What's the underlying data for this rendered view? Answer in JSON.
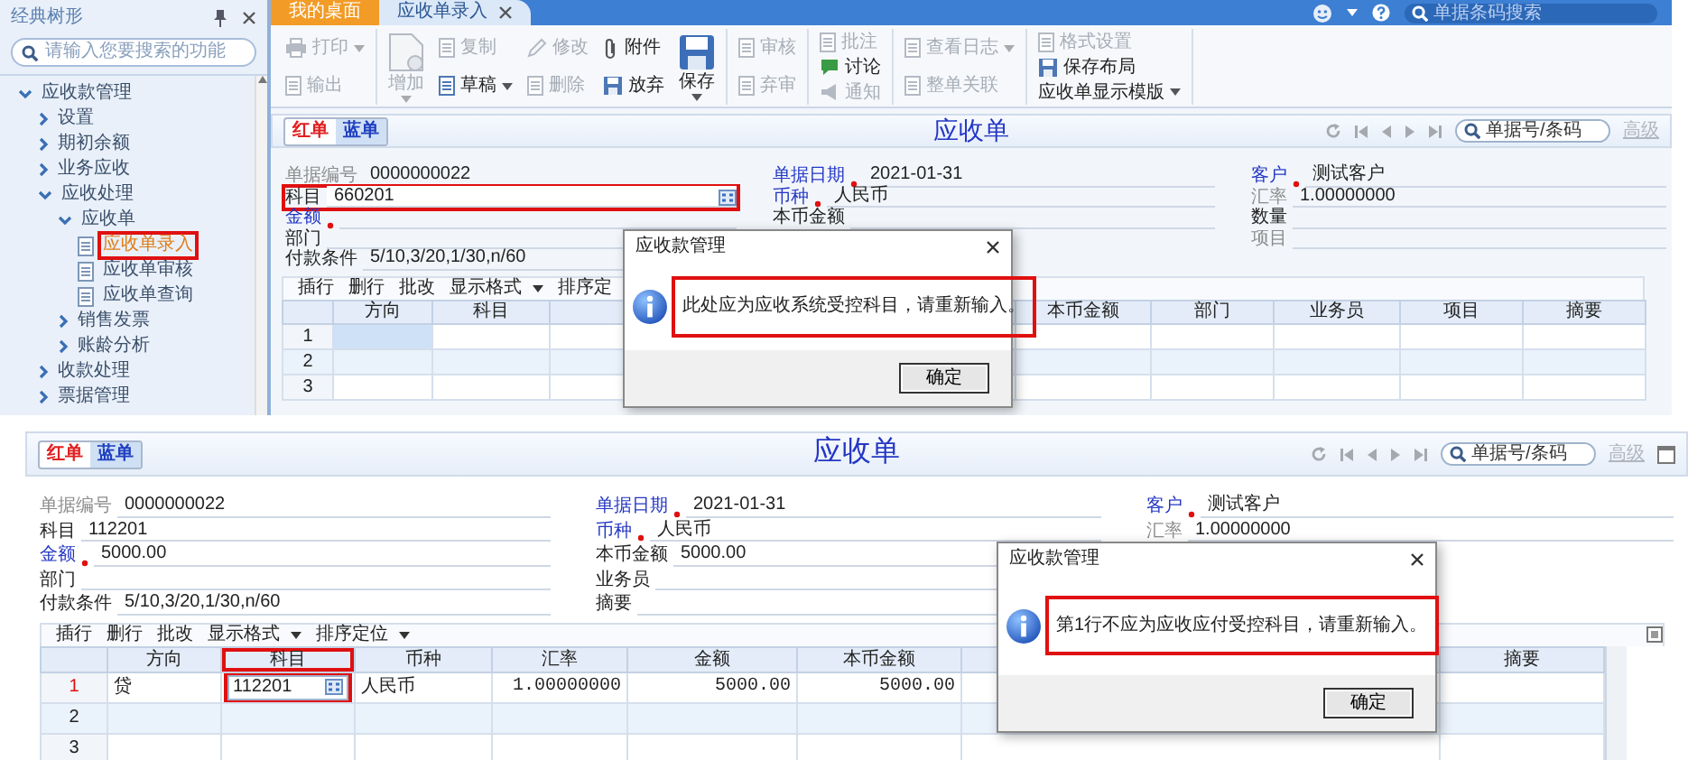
{
  "top_screen": {
    "sidebar": {
      "title": "经典树形",
      "search": {
        "placeholder": "请输入您要搜索的功能"
      },
      "tree": [
        {
          "label": "应收款管理",
          "kind": "folder",
          "expanded": true,
          "selected": false,
          "children": [
            {
              "label": "设置",
              "kind": "folder",
              "expanded": false,
              "selected": false
            },
            {
              "label": "期初余额",
              "kind": "folder",
              "expanded": false,
              "selected": false
            },
            {
              "label": "业务应收",
              "kind": "folder",
              "expanded": false,
              "selected": false
            },
            {
              "label": "应收处理",
              "kind": "folder",
              "expanded": true,
              "selected": false,
              "children": [
                {
                  "label": "应收单",
                  "kind": "folder",
                  "expanded": true,
                  "selected": false,
                  "children": [
                    {
                      "label": "应收单录入",
                      "kind": "page",
                      "selected": true
                    },
                    {
                      "label": "应收单审核",
                      "kind": "page",
                      "selected": false
                    },
                    {
                      "label": "应收单查询",
                      "kind": "page",
                      "selected": false
                    }
                  ]
                },
                {
                  "label": "销售发票",
                  "kind": "folder",
                  "expanded": false,
                  "selected": false
                },
                {
                  "label": "账龄分析",
                  "kind": "folder",
                  "expanded": false,
                  "selected": false
                }
              ]
            },
            {
              "label": "收款处理",
              "kind": "folder",
              "expanded": false,
              "selected": false
            },
            {
              "label": "票据管理",
              "kind": "folder",
              "expanded": false,
              "selected": false
            }
          ]
        }
      ]
    },
    "tabs": [
      {
        "label": "我的桌面",
        "kind": "home",
        "selected": false,
        "closable": false
      },
      {
        "label": "应收单录入",
        "kind": "document",
        "selected": true,
        "closable": true
      }
    ],
    "header_search": {
      "placeholder": "单据条码搜索"
    },
    "toolbar": {
      "groups": [
        {
          "items": [
            {
              "label": "打印",
              "kind": "small",
              "disabled": true,
              "dropdown": true
            },
            {
              "label": "输出",
              "kind": "small",
              "disabled": true,
              "dropdown": false
            }
          ]
        },
        {
          "items": [
            {
              "label": "增加",
              "kind": "large",
              "disabled": true,
              "dropdown": true
            },
            {
              "label": "复制",
              "kind": "small",
              "disabled": true,
              "dropdown": false
            },
            {
              "label": "草稿",
              "kind": "small",
              "disabled": false,
              "dropdown": true
            },
            {
              "label": "修改",
              "kind": "small",
              "disabled": true,
              "dropdown": false
            },
            {
              "label": "删除",
              "kind": "small",
              "disabled": true,
              "dropdown": false
            },
            {
              "label": "附件",
              "kind": "small",
              "disabled": false,
              "dropdown": false
            },
            {
              "label": "放弃",
              "kind": "small",
              "disabled": false,
              "dropdown": false
            },
            {
              "label": "保存",
              "kind": "large",
              "disabled": false,
              "dropdown": true
            }
          ]
        },
        {
          "items": [
            {
              "label": "审核",
              "kind": "small",
              "disabled": true,
              "dropdown": false
            },
            {
              "label": "弃审",
              "kind": "small",
              "disabled": true,
              "dropdown": false
            }
          ]
        },
        {
          "items": [
            {
              "label": "批注",
              "kind": "small",
              "disabled": true,
              "dropdown": false
            },
            {
              "label": "讨论",
              "kind": "small",
              "disabled": false,
              "dropdown": false
            },
            {
              "label": "通知",
              "kind": "small",
              "disabled": true,
              "dropdown": false
            }
          ]
        },
        {
          "items": [
            {
              "label": "查看日志",
              "kind": "small",
              "disabled": true,
              "dropdown": true
            },
            {
              "label": "整单关联",
              "kind": "small",
              "disabled": true,
              "dropdown": false
            }
          ]
        },
        {
          "items": [
            {
              "label": "格式设置",
              "kind": "small",
              "disabled": true,
              "dropdown": false
            },
            {
              "label": "保存布局",
              "kind": "small",
              "disabled": false,
              "dropdown": false
            },
            {
              "label": "应收单显示模版",
              "kind": "small",
              "disabled": false,
              "dropdown": true
            }
          ]
        }
      ]
    },
    "bill": {
      "bill_types": [
        {
          "label": "红单",
          "selected": false,
          "color": "#e02020"
        },
        {
          "label": "蓝单",
          "selected": true,
          "color": "#1f3fbf"
        }
      ],
      "title": "应收单",
      "search": {
        "placeholder": "单据号/条码"
      },
      "advanced_link": {
        "label": "高级",
        "disabled": true
      },
      "field_columns": [
        [
          {
            "label": "单据编号",
            "value": "0000000022",
            "required": false,
            "muted": true,
            "editing": false,
            "highlighted": false
          },
          {
            "label": "科目",
            "value": "660201",
            "required": false,
            "muted": false,
            "editing": true,
            "highlighted": true
          },
          {
            "label": "金额",
            "required": true,
            "muted": false,
            "editing": false,
            "highlighted": false
          },
          {
            "label": "部门",
            "required": false,
            "muted": false,
            "editing": false,
            "highlighted": false
          },
          {
            "label": "付款条件",
            "value": "5/10,3/20,1/30,n/60",
            "required": false,
            "muted": false,
            "editing": false,
            "highlighted": false
          }
        ],
        [
          {
            "label": "单据日期",
            "value": "2021-01-31",
            "required": true,
            "muted": false,
            "editing": false,
            "highlighted": false
          },
          {
            "label": "币种",
            "value": "人民币",
            "required": true,
            "muted": false,
            "editing": false,
            "highlighted": false
          },
          {
            "label": "本币金额",
            "required": false,
            "muted": false,
            "editing": false,
            "highlighted": false
          }
        ],
        [
          {
            "label": "客户",
            "value": "测试客户",
            "required": true,
            "muted": false,
            "editing": false,
            "highlighted": false
          },
          {
            "label": "汇率",
            "value": "1.00000000",
            "required": false,
            "muted": true,
            "editing": false,
            "highlighted": false
          },
          {
            "label": "数量",
            "required": false,
            "muted": false,
            "editing": false,
            "highlighted": false
          },
          {
            "label": "项目",
            "required": false,
            "muted": true,
            "editing": false,
            "highlighted": false
          }
        ]
      ],
      "grid": {
        "toolbar": [
          {
            "label": "插行",
            "dropdown": false
          },
          {
            "label": "删行",
            "dropdown": false
          },
          {
            "label": "批改",
            "dropdown": false
          },
          {
            "label": "显示格式",
            "dropdown": true
          },
          {
            "label": "排序定",
            "dropdown": false
          }
        ],
        "columns": [
          {
            "label": "方向",
            "highlighted": false
          },
          {
            "label": "科目",
            "highlighted": false
          },
          {
            "label": "本币金额",
            "highlighted": false
          },
          {
            "label": "部门",
            "highlighted": false
          },
          {
            "label": "业务员",
            "highlighted": false
          },
          {
            "label": "项目",
            "highlighted": false
          },
          {
            "label": "摘要",
            "highlighted": false
          }
        ],
        "rows": [
          {
            "number": "1",
            "current": false,
            "cells": [
              {
                "selected": true,
                "editing": false,
                "highlighted": false
              }
            ]
          },
          {
            "number": "2",
            "current": false
          },
          {
            "number": "3",
            "current": false
          }
        ]
      },
      "dialog": {
        "title": "应收款管理",
        "message": "此处应为应收系统受控科目，请重新输入。",
        "highlighted": true,
        "button": "确定"
      }
    }
  },
  "bottom_screen": {
    "bill": {
      "bill_types": [
        {
          "label": "红单",
          "selected": false,
          "color": "#e02020"
        },
        {
          "label": "蓝单",
          "selected": true,
          "color": "#1f3fbf"
        }
      ],
      "title": "应收单",
      "search": {
        "placeholder": "单据号/条码"
      },
      "advanced_link": {
        "label": "高级",
        "disabled": true
      },
      "field_columns": [
        [
          {
            "label": "单据编号",
            "value": "0000000022",
            "required": false,
            "muted": true,
            "editing": false,
            "highlighted": false
          },
          {
            "label": "科目",
            "value": "112201",
            "required": false,
            "muted": false,
            "editing": false,
            "highlighted": false
          },
          {
            "label": "金额",
            "value": "5000.00",
            "required": true,
            "muted": false,
            "editing": false,
            "highlighted": false
          },
          {
            "label": "部门",
            "required": false,
            "muted": false,
            "editing": false,
            "highlighted": false
          },
          {
            "label": "付款条件",
            "value": "5/10,3/20,1/30,n/60",
            "required": false,
            "muted": false,
            "editing": false,
            "highlighted": false
          }
        ],
        [
          {
            "label": "单据日期",
            "value": "2021-01-31",
            "required": true,
            "muted": false,
            "editing": false,
            "highlighted": false
          },
          {
            "label": "币种",
            "value": "人民币",
            "required": true,
            "muted": false,
            "editing": false,
            "highlighted": false
          },
          {
            "label": "本币金额",
            "value": "5000.00",
            "required": false,
            "muted": false,
            "editing": false,
            "highlighted": false
          },
          {
            "label": "业务员",
            "required": false,
            "muted": false,
            "editing": false,
            "highlighted": false
          },
          {
            "label": "摘要",
            "required": false,
            "muted": false,
            "editing": false,
            "highlighted": false
          }
        ],
        [
          {
            "label": "客户",
            "value": "测试客户",
            "required": true,
            "muted": false,
            "editing": false,
            "highlighted": false
          },
          {
            "label": "汇率",
            "value": "1.00000000",
            "required": false,
            "muted": true,
            "editing": false,
            "highlighted": false
          }
        ]
      ],
      "grid": {
        "toolbar": [
          {
            "label": "插行",
            "dropdown": false
          },
          {
            "label": "删行",
            "dropdown": false
          },
          {
            "label": "批改",
            "dropdown": false
          },
          {
            "label": "显示格式",
            "dropdown": true
          },
          {
            "label": "排序定位",
            "dropdown": true
          }
        ],
        "columns": [
          {
            "label": "方向",
            "kind": "text",
            "highlighted": false
          },
          {
            "label": "科目",
            "kind": "text",
            "highlighted": true
          },
          {
            "label": "币种",
            "kind": "text",
            "highlighted": false
          },
          {
            "label": "汇率",
            "kind": "number",
            "highlighted": false
          },
          {
            "label": "金额",
            "kind": "number",
            "highlighted": false
          },
          {
            "label": "本币金额",
            "kind": "number",
            "highlighted": false
          },
          {
            "label": "摘要",
            "highlighted": false
          }
        ],
        "rows": [
          {
            "number": "1",
            "current": true,
            "cells": [
              {
                "text": "贷",
                "selected": false,
                "editing": false,
                "highlighted": false
              },
              {
                "text": "112201",
                "selected": false,
                "editing": true,
                "highlighted": true
              },
              {
                "text": "人民币",
                "selected": false,
                "editing": false,
                "highlighted": false
              },
              {
                "text": "1.00000000",
                "selected": false,
                "editing": false,
                "highlighted": false
              },
              {
                "text": "5000.00",
                "selected": false,
                "editing": false,
                "highlighted": false
              },
              {
                "text": "5000.00",
                "selected": false,
                "editing": false,
                "highlighted": false
              }
            ]
          },
          {
            "number": "2",
            "current": false
          },
          {
            "number": "3",
            "current": false
          }
        ]
      },
      "dialog": {
        "title": "应收款管理",
        "message": "第1行不应为应收应付受控科目，请重新输入。",
        "highlighted": true,
        "button": "确定"
      }
    }
  }
}
